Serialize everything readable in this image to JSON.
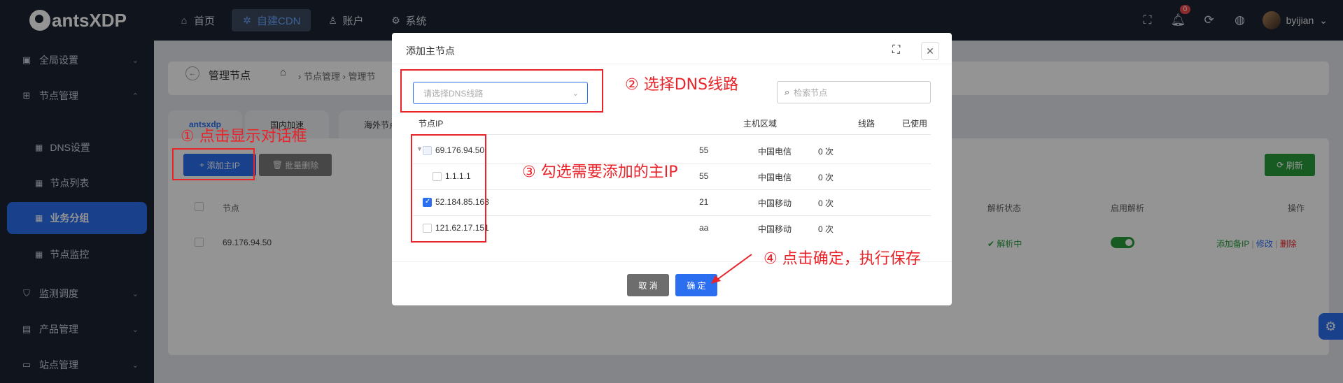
{
  "app": {
    "logo": "antsXDP"
  },
  "topnav": [
    {
      "label": "首页",
      "icon": "home-icon"
    },
    {
      "label": "自建CDN",
      "icon": "cdn-icon",
      "active": true
    },
    {
      "label": "账户",
      "icon": "user-icon"
    },
    {
      "label": "系统",
      "icon": "gear-icon"
    }
  ],
  "topbar": {
    "notification_count": "0",
    "username": "byijian"
  },
  "sidebar": {
    "global": "全局设置",
    "node_mgmt": "节点管理",
    "dns": "DNS设置",
    "node_list": "节点列表",
    "biz_group": "业务分组",
    "node_monitor": "节点监控",
    "monitor": "监测调度",
    "product": "产品管理",
    "site": "站点管理"
  },
  "page": {
    "title": "管理节点",
    "breadcrumb_1": "节点管理",
    "breadcrumb_2": "管理节",
    "tabs": [
      "antsxdp",
      "国内加速",
      "海外节点"
    ],
    "add_button": "添加主IP",
    "batch_delete": "批量删除",
    "refresh": "刷新",
    "columns": {
      "node": "节点",
      "resolve_status": "解析状态",
      "enable_resolve": "启用解析",
      "ops": "操作"
    },
    "row": {
      "node": "69.176.94.50",
      "status": "解析中",
      "actions": {
        "add_backup": "添加备IP",
        "edit": "修改",
        "delete": "删除"
      }
    }
  },
  "modal": {
    "title": "添加主节点",
    "dns_placeholder": "请选择DNS线路",
    "search_placeholder": "检索节点",
    "columns": {
      "ip": "节点IP",
      "region": "主机区域",
      "line": "线路",
      "used": "已使用"
    },
    "rows": [
      {
        "ip": "69.176.94.50",
        "region": "55",
        "line": "中国电信",
        "used": "0 次",
        "state": "indeterminate",
        "parent": true
      },
      {
        "ip": "1.1.1.1",
        "region": "55",
        "line": "中国电信",
        "used": "0 次",
        "state": "unchecked",
        "child": true
      },
      {
        "ip": "52.184.85.163",
        "region": "21",
        "line": "中国移动",
        "used": "0 次",
        "state": "checked"
      },
      {
        "ip": "121.62.17.151",
        "region": "aa",
        "line": "中国移动",
        "used": "0 次",
        "state": "unchecked"
      }
    ],
    "cancel": "取 消",
    "confirm": "确 定"
  },
  "annotations": {
    "step1": "① 点击显示对话框",
    "step2": "② 选择DNS线路",
    "step3": "③ 勾选需要添加的主IP",
    "step4": "④ 点击确定，执行保存"
  },
  "colors": {
    "primary": "#2b6ff0",
    "annotation": "#e8242a",
    "success": "#2a9d3b",
    "topbar": "#1c2333"
  }
}
